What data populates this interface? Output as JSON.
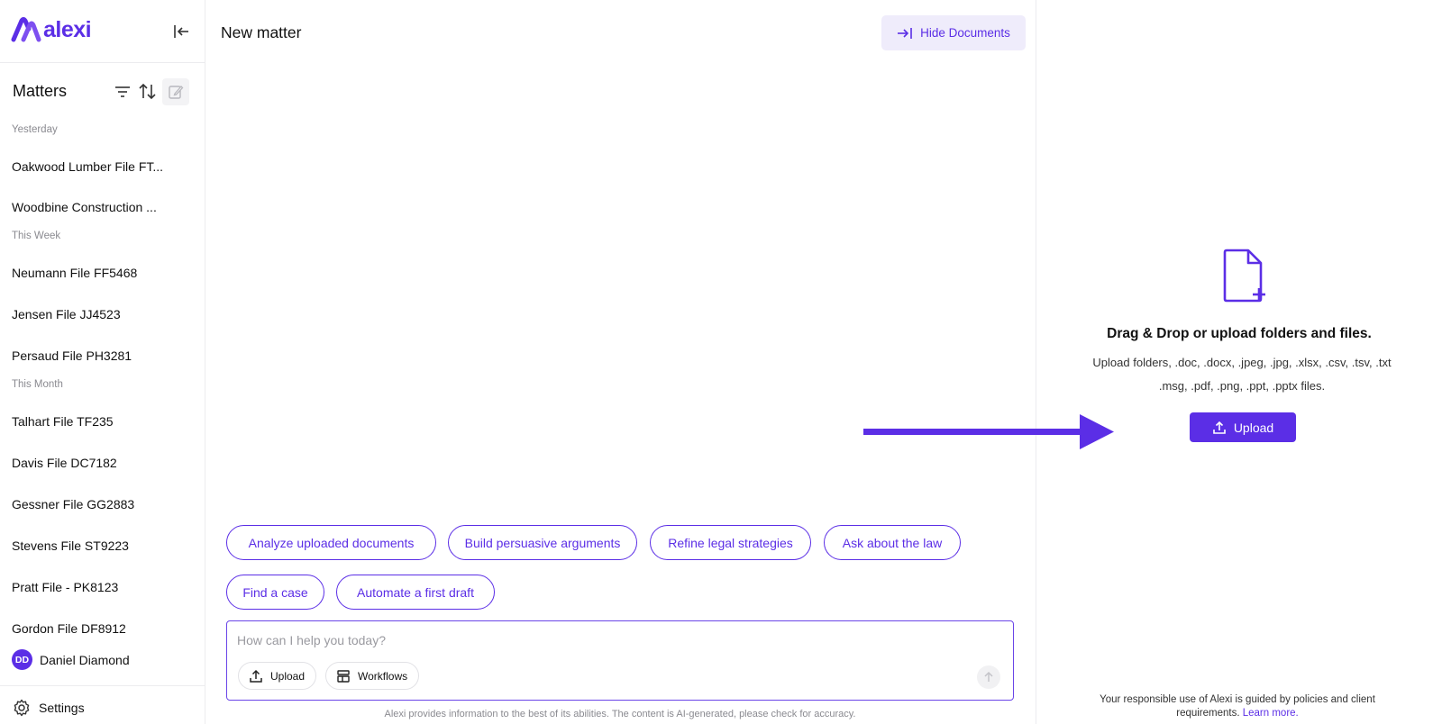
{
  "app": {
    "logo_text": "alexi",
    "brand_color": "#5b2ee6"
  },
  "sidebar": {
    "title": "Matters",
    "groups": [
      {
        "label": "Yesterday",
        "items": [
          "Oakwood Lumber File FT...",
          "Woodbine Construction ..."
        ]
      },
      {
        "label": "This Week",
        "items": [
          "Neumann File FF5468",
          "Jensen File JJ4523",
          "Persaud File PH3281"
        ]
      },
      {
        "label": "This Month",
        "items": [
          "Talhart File TF235",
          "Davis File DC7182",
          "Gessner File GG2883",
          "Stevens File ST9223",
          "Pratt File - PK8123",
          "Gordon File DF8912"
        ]
      }
    ],
    "user": {
      "initials": "DD",
      "name": "Daniel Diamond"
    },
    "settings_label": "Settings"
  },
  "main": {
    "title": "New matter",
    "hide_documents_label": "Hide Documents",
    "suggestions": [
      "Analyze uploaded documents",
      "Build persuasive arguments",
      "Refine legal strategies",
      "Ask about the law",
      "Find a case",
      "Automate a first draft"
    ],
    "chat": {
      "placeholder": "How can I help you today?",
      "upload_label": "Upload",
      "workflows_label": "Workflows"
    },
    "disclaimer": "Alexi provides information to the best of its abilities. The content is AI-generated, please check for accuracy."
  },
  "documents": {
    "drop_title": "Drag & Drop or upload folders and files.",
    "drop_desc": "Upload folders, .doc, .docx, .jpeg, .jpg, .xlsx, .csv, .tsv, .txt .msg, .pdf, .png, .ppt, .pptx files.",
    "upload_label": "Upload",
    "policy_text": "Your responsible use of Alexi is guided by policies and client requirements.",
    "learn_more": "Learn more."
  }
}
